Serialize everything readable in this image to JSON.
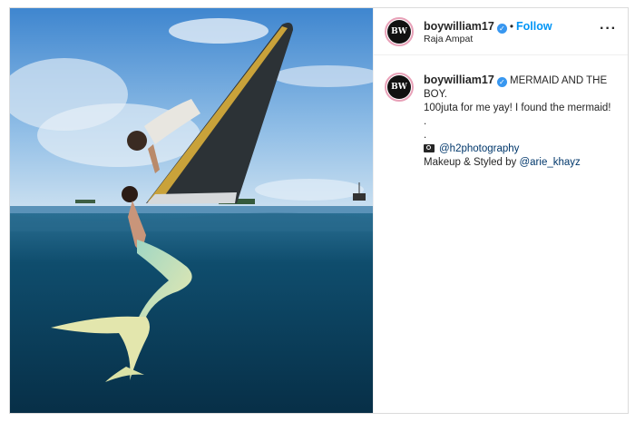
{
  "post": {
    "username": "boywilliam17",
    "location": "Raja Ampat",
    "follow_label": "Follow",
    "dot": "•",
    "more_label": "···",
    "avatar_text": "BW"
  },
  "caption": {
    "username": "boywilliam17",
    "line1": " MERMAID AND THE BOY.",
    "line2": "100juta for me yay! I found the mermaid!",
    "dot1": ".",
    "dot2": ".",
    "photo_credit": "@h2photography",
    "styled_prefix": "Makeup & Styled by ",
    "styled_handle": "@arie_khayz"
  },
  "colors": {
    "accent": "#0095f6",
    "verified": "#3897f0",
    "link": "#00376b"
  },
  "icons": {
    "verified": "verified-badge-icon",
    "camera": "camera-icon",
    "more": "more-options-icon"
  }
}
